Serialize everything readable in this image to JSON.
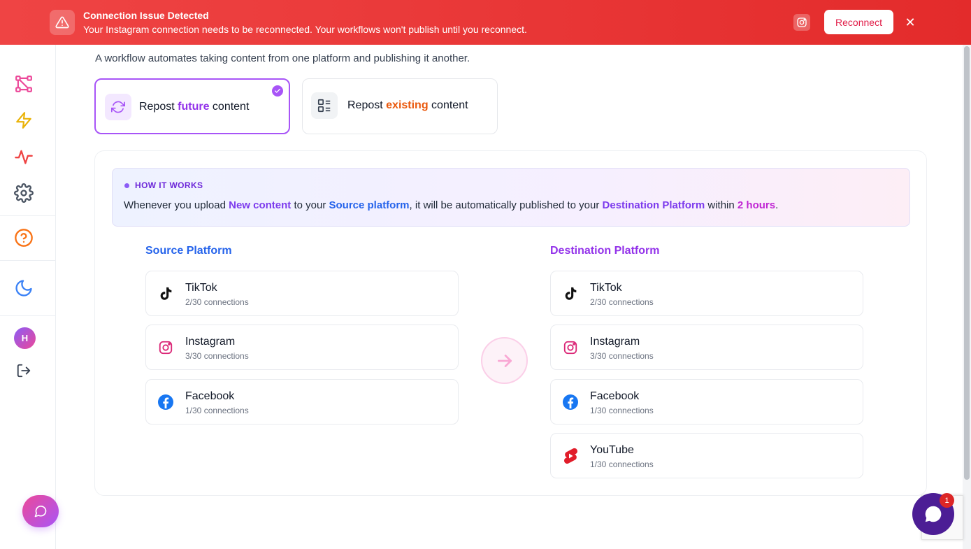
{
  "banner": {
    "title": "Connection Issue Detected",
    "message": "Your Instagram connection needs to be reconnected. Your workflows won't publish until you reconnect.",
    "reconnect_label": "Reconnect",
    "close_glyph": "✕",
    "icons": [
      "warning-icon",
      "instagram-icon",
      "close-icon"
    ],
    "color": "#e32b2b"
  },
  "sidebar": {
    "items": [
      {
        "name": "workflows-icon",
        "color": "#ec4899"
      },
      {
        "name": "lightning-icon",
        "color": "#eab308"
      },
      {
        "name": "activity-icon",
        "color": "#ef4444"
      },
      {
        "name": "gear-icon",
        "color": "#4b5563"
      },
      {
        "name": "help-icon",
        "color": "#f97316"
      },
      {
        "name": "moon-icon",
        "color": "#3b82f6"
      }
    ],
    "avatar_initial": "H",
    "logout_icon": "logout-icon",
    "chat_icon": "chat-icon"
  },
  "main": {
    "intro": "A workflow automates taking content from one platform and publishing it another.",
    "tabs": [
      {
        "prefix": "Repost ",
        "keyword": "future",
        "suffix": " content",
        "selected": true,
        "icon": "refresh-icon"
      },
      {
        "prefix": "Repost ",
        "keyword": "existing",
        "suffix": " content",
        "selected": false,
        "icon": "list-icon"
      }
    ],
    "how_it_works": {
      "title": "HOW IT WORKS",
      "text_1": "Whenever you upload ",
      "new_content": "New content",
      "text_2": " to your ",
      "source_platform": "Source platform",
      "text_3": ", it will be automatically published to your ",
      "destination_platform": "Destination Platform",
      "text_4": " within ",
      "hours": "2 hours",
      "text_5": "."
    },
    "source": {
      "title": "Source Platform",
      "platforms": [
        {
          "name": "TikTok",
          "connections": "2/30 connections",
          "icon": "tiktok-icon"
        },
        {
          "name": "Instagram",
          "connections": "3/30 connections",
          "icon": "instagram-icon"
        },
        {
          "name": "Facebook",
          "connections": "1/30 connections",
          "icon": "facebook-icon"
        }
      ]
    },
    "destination": {
      "title": "Destination Platform",
      "platforms": [
        {
          "name": "TikTok",
          "connections": "2/30 connections",
          "icon": "tiktok-icon"
        },
        {
          "name": "Instagram",
          "connections": "3/30 connections",
          "icon": "instagram-icon"
        },
        {
          "name": "Facebook",
          "connections": "1/30 connections",
          "icon": "facebook-icon"
        },
        {
          "name": "YouTube",
          "connections": "1/30 connections",
          "icon": "youtube-icon"
        }
      ]
    },
    "arrow_icon": "arrow-right-icon"
  },
  "chat_widget": {
    "badge": "1",
    "icon": "chat-bubble-icon"
  },
  "colors": {
    "brand_purple": "#a855f7",
    "source_blue": "#2563eb",
    "destination_purple": "#9333ea",
    "future_purple": "#9333ea",
    "existing_orange": "#ea580c"
  }
}
